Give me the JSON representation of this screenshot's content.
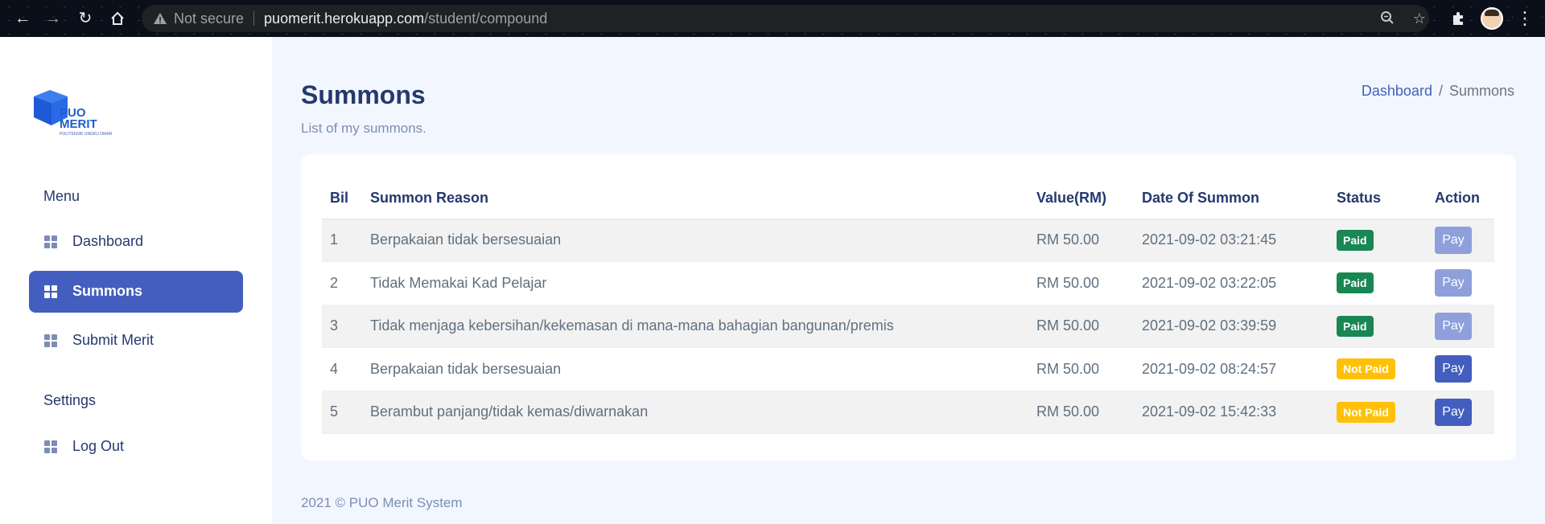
{
  "browser": {
    "security_label": "Not secure",
    "url_host": "puomerit.herokuapp.com",
    "url_path": "/student/compound"
  },
  "logo": {
    "line1": "PUO",
    "line2": "MERIT",
    "tagline": "POLITEKNIK UNGKU OMAR"
  },
  "sidebar": {
    "menu_title": "Menu",
    "items": [
      {
        "label": "Dashboard",
        "active": false
      },
      {
        "label": "Summons",
        "active": true
      },
      {
        "label": "Submit Merit",
        "active": false
      }
    ],
    "settings_title": "Settings",
    "settings_items": [
      {
        "label": "Log Out"
      }
    ]
  },
  "header": {
    "title": "Summons",
    "subtitle": "List of my summons.",
    "breadcrumb": [
      "Dashboard",
      "Summons"
    ],
    "breadcrumb_sep": "/"
  },
  "table": {
    "headers": [
      "Bil",
      "Summon Reason",
      "Value(RM)",
      "Date Of Summon",
      "Status",
      "Action"
    ],
    "rows": [
      {
        "bil": "1",
        "reason": "Berpakaian tidak bersesuaian",
        "value": "RM 50.00",
        "date": "2021-09-02 03:21:45",
        "status": "Paid",
        "action": "Pay"
      },
      {
        "bil": "2",
        "reason": "Tidak Memakai Kad Pelajar",
        "value": "RM 50.00",
        "date": "2021-09-02 03:22:05",
        "status": "Paid",
        "action": "Pay"
      },
      {
        "bil": "3",
        "reason": "Tidak menjaga kebersihan/kekemasan di mana-mana bahagian bangunan/premis",
        "value": "RM 50.00",
        "date": "2021-09-02 03:39:59",
        "status": "Paid",
        "action": "Pay"
      },
      {
        "bil": "4",
        "reason": "Berpakaian tidak bersesuaian",
        "value": "RM 50.00",
        "date": "2021-09-02 08:24:57",
        "status": "Not Paid",
        "action": "Pay"
      },
      {
        "bil": "5",
        "reason": "Berambut panjang/tidak kemas/diwarnakan",
        "value": "RM 50.00",
        "date": "2021-09-02 15:42:33",
        "status": "Not Paid",
        "action": "Pay"
      }
    ]
  },
  "footer": {
    "text": "2021 © PUO Merit System"
  },
  "colors": {
    "primary": "#435ebe",
    "paid": "#198754",
    "not_paid": "#ffc107",
    "page_bg": "#f2f7ff"
  }
}
